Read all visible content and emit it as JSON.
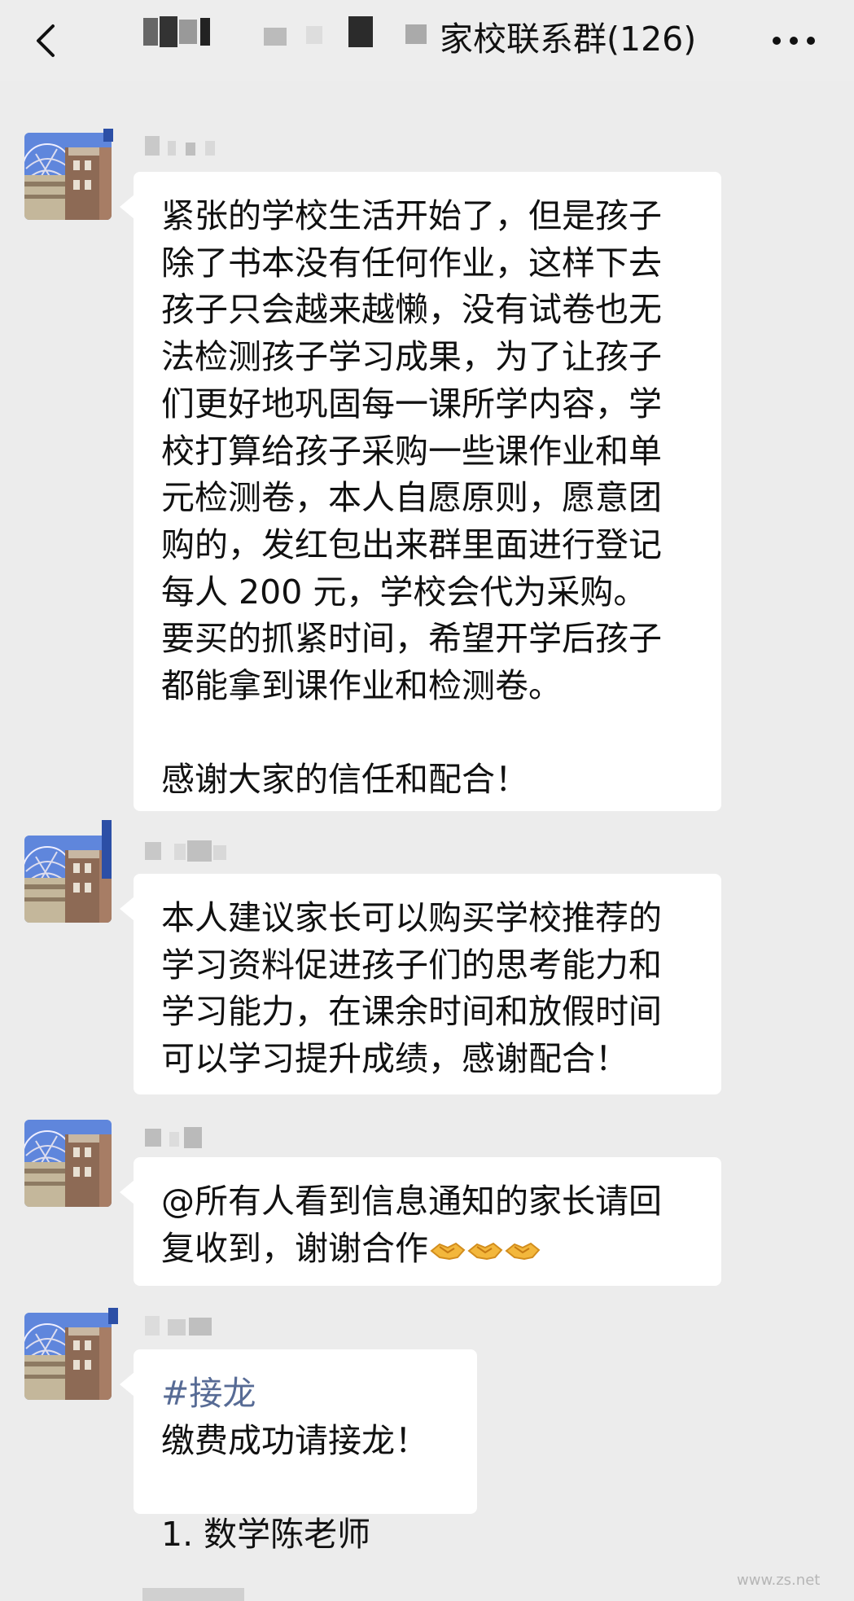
{
  "header": {
    "title": "家校联系群(126)",
    "back_icon": "chevron-left-icon",
    "more_icon": "more-dots-icon"
  },
  "messages": [
    {
      "lines": [
        "紧张的学校生活开始了，但是孩子",
        "除了书本没有任何作业，这样下去",
        "孩子只会越来越懒，没有试卷也无",
        "法检测孩子学习成果，为了让孩子",
        "们更好地巩固每一课所学内容，学",
        "校打算给孩子采购一些课作业和单",
        "元检测卷，本人自愿原则，愿意团",
        "购的，发红包出来群里面进行登记",
        "每人 200 元，学校会代为采购。",
        "要买的抓紧时间，希望开学后孩子",
        "都能拿到课作业和检测卷。"
      ],
      "closing": "感谢大家的信任和配合！"
    },
    {
      "lines": [
        "本人建议家长可以购买学校推荐的",
        "学习资料促进孩子们的思考能力和",
        "学习能力，在课余时间和放假时间",
        "可以学习提升成绩，感谢配合！"
      ]
    },
    {
      "lines": [
        "@所有人看到信息通知的家长请回",
        "复收到，谢谢合作"
      ],
      "emoji": "handshake-emoji"
    },
    {
      "hashtag": "#接龙",
      "line": "缴费成功请接龙！",
      "list_item": "1. 数学陈老师"
    }
  ],
  "watermark": "www.zs.net",
  "colors": {
    "background": "#ececec",
    "bubble": "#ffffff",
    "hashtag": "#576b95"
  }
}
